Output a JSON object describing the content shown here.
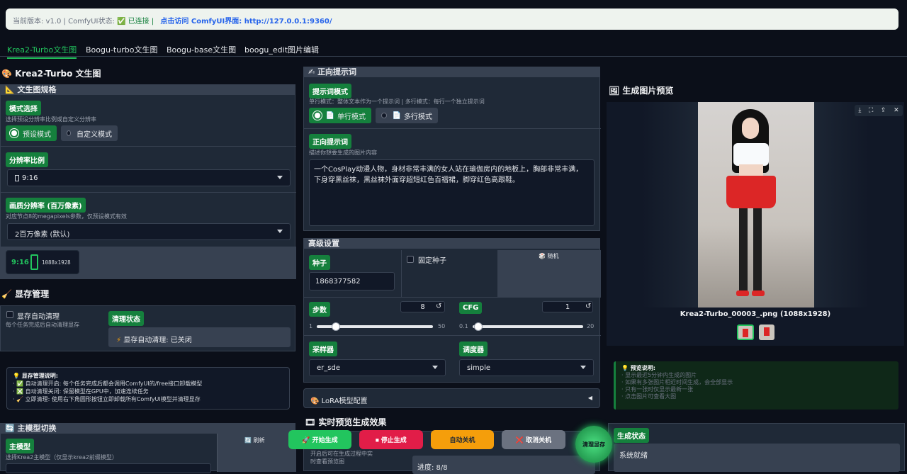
{
  "topbar": {
    "version": "当前版本: v1.0 | ComfyUI状态: ",
    "status": "✅ 已连接 |",
    "link": "点击访问 ComfyUI界面: http://127.0.0.1:9360/"
  },
  "tabs": [
    "Krea2-Turbo文生图",
    "Boogu-turbo文生图",
    "Boogu-base文生图",
    "boogu_edit图片编辑"
  ],
  "left": {
    "title": "Krea2-Turbo 文生图",
    "spec_title": "文生图规格",
    "mode_label": "模式选择",
    "mode_hint": "选择预设分辨率比例或自定义分辨率",
    "mode_preset": "预设模式",
    "mode_custom": "自定义模式",
    "ratio_label": "分辨率比例",
    "ratio_value": "9:16",
    "quality_label": "画质分辨率 (百万像素)",
    "quality_hint": "对应节点8的megapixels参数，仅预设模式有效",
    "quality_value": "2百万像素 (默认)",
    "preview_ratio": "9:16",
    "preview_size": "1088x1928",
    "mem_title": "显存管理",
    "auto_clean": "显存自动清理",
    "auto_clean_hint": "每个任务完成后自动清理显存",
    "clean_state_label": "清理状态",
    "clean_state_value": "显存自动清理: 已关闭",
    "mem_info": [
      "💡 显存管理说明:",
      "· ✅ 自动清理开启: 每个任务完成后都会调用ComfyUI的/free接口卸载模型",
      "· ❎ 自动清理关闭: 保留模型在GPU中，加速连续任务",
      "· 🧹 立即清理: 使用右下角圆形按钮立即卸载所有ComfyUI模型并清理显存"
    ],
    "model_title": "主模型切换",
    "model_label": "主模型",
    "model_hint": "选择Krea2主模型（仅显示krea2前缀模型）",
    "refresh": "🔄 刷新"
  },
  "mid": {
    "prompt_title": "正向提示词",
    "prompt_mode_label": "提示词模式",
    "prompt_mode_hint": "单行模式：整体文本作为一个提示词 | 多行模式：每行一个独立提示词",
    "single": "单行模式",
    "multi": "多行模式",
    "pos_label": "正向提示词",
    "pos_hint": "描述你想要生成的图片内容",
    "pos_text": "一个CosPlay动漫人物，身材非常丰满的女人站在瑜伽房内的地板上，胸部非常丰满，下身穿黑丝袜，黑丝袜外面穿超短红色百褶裙，脚穿红色高跟鞋。",
    "adv_title": "高级设置",
    "seed_label": "种子",
    "seed_value": "1868377582",
    "fixed_seed": "固定种子",
    "random": "🎲 随机",
    "steps_label": "步数",
    "steps_value": "8",
    "steps_min": "1",
    "steps_max": "50",
    "cfg_label": "CFG",
    "cfg_value": "1",
    "cfg_min": "0.1",
    "cfg_max": "20",
    "sampler_label": "采样器",
    "sampler_value": "er_sde",
    "scheduler_label": "调度器",
    "scheduler_value": "simple",
    "lora": "LoRA模型配置",
    "live_title": "实时预览生成效果",
    "live_hint": "开启后可在生成过程中实时查看预览图",
    "progress": "进度: 8/8"
  },
  "right": {
    "preview_title": "生成图片预览",
    "caption": "Krea2-Turbo_00003_.png (1088x1928)",
    "tips": [
      "💡 预览说明:",
      "· 显示最近5分钟内生成的图片",
      "· 如果有多张图片相近时间生成，会全部显示",
      "· 只有一张时仅显示最新一张",
      "· 点击图片可查看大图"
    ],
    "status_label": "生成状态",
    "status_value": "系统就绪"
  },
  "actions": {
    "start": "🚀 开始生成",
    "stop": "⏹ 停止生成",
    "auto_off": "自动关机",
    "cancel_off": "❌ 取消关机",
    "clear": "清理显存"
  },
  "colors": {
    "accent": "#22c55e",
    "bg": "#0b0f19",
    "panel": "#1f2937",
    "stop": "#e11d48",
    "auto_off": "#f59e0b"
  }
}
